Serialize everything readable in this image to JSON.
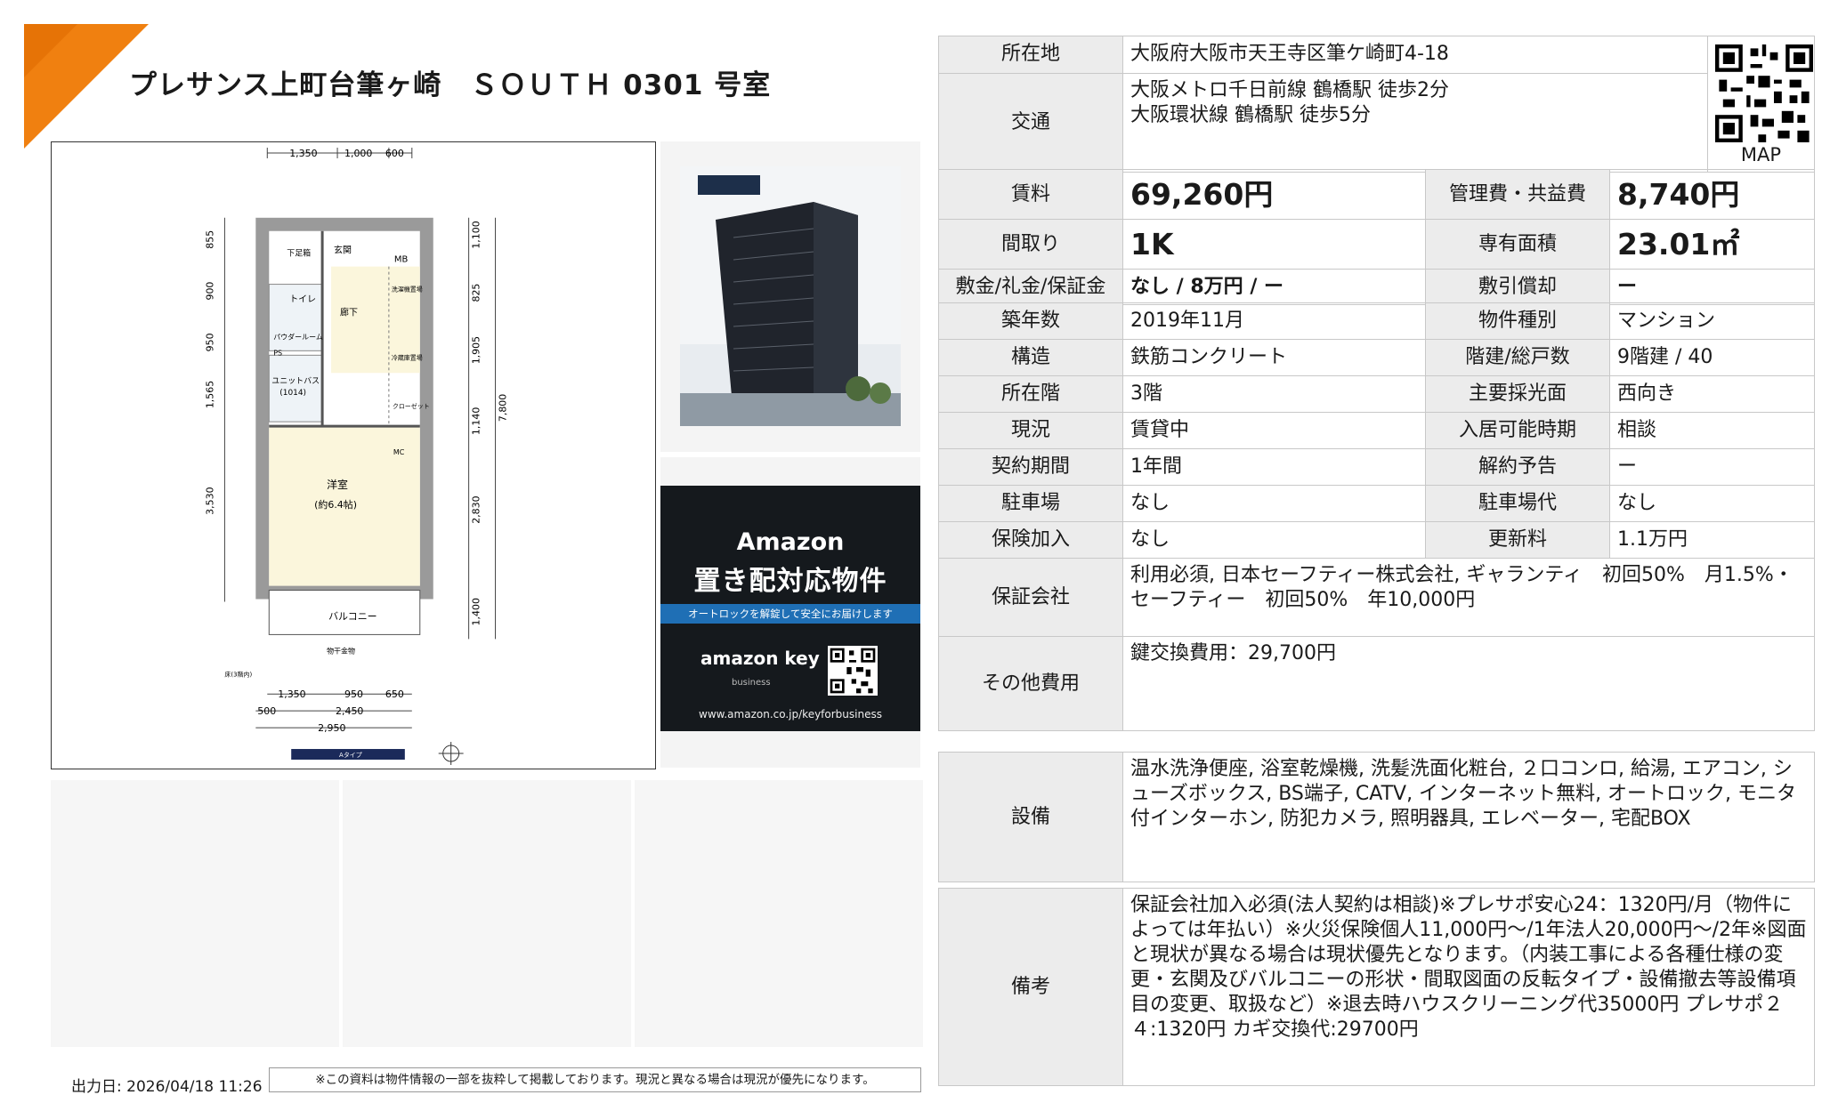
{
  "header": {
    "title": "プレサンス上町台筆ヶ崎　ＳＯＵＴＨ 0301 号室"
  },
  "colors": {
    "accent_orange": "#f08010",
    "label_bg": "#ececec",
    "amazon_bg": "#15191d",
    "amazon_stripe": "#1f6fb5",
    "floorplan_floor": "#fbf6dc",
    "floorplan_wall": "#9a9a9a"
  },
  "floorplan": {
    "dims_top": [
      "1,350",
      "1,000",
      "600"
    ],
    "dims_bottom_row1": [
      "1,350",
      "950",
      "650"
    ],
    "dims_bottom_row2": [
      "500",
      "2,450"
    ],
    "dims_bottom_row3": "2,950",
    "dims_left": [
      "855",
      "900",
      "950",
      "1,565",
      "3,530"
    ],
    "dims_right_inner": [
      "1,100",
      "825",
      "1,905",
      "1,140",
      "2,830",
      "1,400"
    ],
    "dims_right_outer": "7,800",
    "rooms": {
      "entrance": "玄関",
      "shoebox": "下足箱",
      "mb": "MB",
      "toilet": "トイレ",
      "powder": "パウダールーム",
      "corridor": "廊下",
      "unit_bath": "ユニットバス",
      "unit_bath_size": "(1014)",
      "ps": "PS",
      "washroom_storage": "洗濯機置場",
      "fridge": "冷蔵庫置場",
      "closet": "クローゼット",
      "western_room": "洋室",
      "western_room_size": "(約6.4帖)",
      "mc": "MC",
      "balcony": "バルコニー",
      "outdoor_unit": "物干金物",
      "floor_note": "床(3階内)",
      "type_label": "Aタイプ"
    }
  },
  "amazon_banner": {
    "title": "Amazon",
    "subtitle": "置き配対応物件",
    "stripe": "オートロックを解錠して安全にお届けします",
    "brand": "amazon key",
    "brand_sub": "business",
    "url": "www.amazon.co.jp/keyforbusiness"
  },
  "qr_caption": "MAP",
  "table1": {
    "address_label": "所在地",
    "address_value": "大阪府大阪市天王寺区筆ケ崎町4-18",
    "transport_label": "交通",
    "transport_value": "大阪メトロ千日前線 鶴橋駅 徒歩2分\n大阪環状線 鶴橋駅 徒歩5分"
  },
  "table2": {
    "rent_label": "賃料",
    "rent_value": "69,260円",
    "mgmt_label": "管理費・共益費",
    "mgmt_value": "8,740円",
    "layout_label": "間取り",
    "layout_value": "1K",
    "area_label": "専有面積",
    "area_value": "23.01㎡",
    "deposit_label": "敷金/礼金/保証金",
    "deposit_value": "なし / 8万円 / ー",
    "amortization_label": "敷引償却",
    "amortization_value": "ー"
  },
  "table3": {
    "rows": [
      {
        "l1": "築年数",
        "v1": "2019年11月",
        "l2": "物件種別",
        "v2": "マンション"
      },
      {
        "l1": "構造",
        "v1": "鉄筋コンクリート",
        "l2": "階建/総戸数",
        "v2": "9階建 / 40"
      },
      {
        "l1": "所在階",
        "v1": "3階",
        "l2": "主要採光面",
        "v2": "西向き"
      },
      {
        "l1": "現況",
        "v1": "賃貸中",
        "l2": "入居可能時期",
        "v2": "相談"
      },
      {
        "l1": "契約期間",
        "v1": "1年間",
        "l2": "解約予告",
        "v2": "ー"
      },
      {
        "l1": "駐車場",
        "v1": "なし",
        "l2": "駐車場代",
        "v2": "なし"
      },
      {
        "l1": "保険加入",
        "v1": "なし",
        "l2": "更新料",
        "v2": "1.1万円"
      }
    ],
    "guarantor_label": "保証会社",
    "guarantor_value": "利用必須, 日本セーフティー株式会社, ギャランティ　初回50%　月1.5%・セーフティー　初回50%　年10,000円",
    "other_fees_label": "その他費用",
    "other_fees_value": "鍵交換費用：29,700円"
  },
  "table4": {
    "label": "設備",
    "value": "温水洗浄便座, 浴室乾燥機, 洗髪洗面化粧台, ２口コンロ, 給湯, エアコン, シューズボックス, BS端子, CATV, インターネット無料, オートロック, モニタ付インターホン, 防犯カメラ, 照明器具, エレベーター, 宅配BOX"
  },
  "table5": {
    "label": "備考",
    "value": "保証会社加入必須(法人契約は相談)※プレサポ安心24：1320円/月（物件によっては年払い）※火災保険個人11,000円〜/1年法人20,000円〜/2年※図面と現状が異なる場合は現状優先となります。（内装工事による各種仕様の変更・玄関及びバルコニーの形状・間取図面の反転タイプ・設備撤去等設備項目の変更、取扱など）※退去時ハウスクリーニング代35000円 プレサポ２４:1320円 カギ交換代:29700円"
  },
  "footer": {
    "issue_date": "出力日: 2026/04/18 11:26",
    "disclaimer": "※この資料は物件情報の一部を抜粋して掲載しております。現況と異なる場合は現況が優先になります。"
  }
}
